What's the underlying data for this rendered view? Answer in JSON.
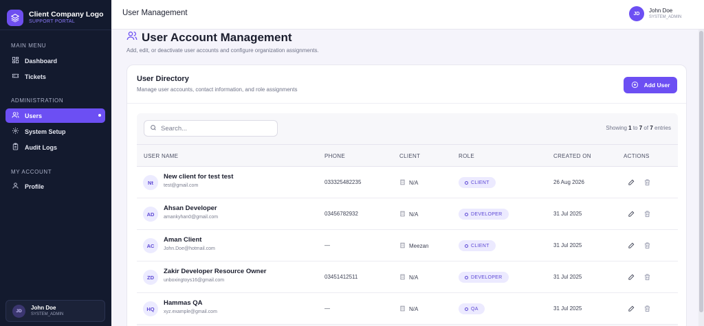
{
  "brand": {
    "title": "Client Company Logo",
    "subtitle": "SUPPORT PORTAL"
  },
  "sidebar": {
    "sections": [
      {
        "label": "MAIN MENU"
      },
      {
        "label": "ADMINISTRATION"
      },
      {
        "label": "MY ACCOUNT"
      }
    ],
    "items": [
      {
        "label": "Dashboard",
        "icon": "dashboard-icon"
      },
      {
        "label": "Tickets",
        "icon": "ticket-icon"
      },
      {
        "label": "Users",
        "icon": "users-icon",
        "active": true
      },
      {
        "label": "System Setup",
        "icon": "gear-icon"
      },
      {
        "label": "Audit Logs",
        "icon": "clipboard-icon"
      },
      {
        "label": "Profile",
        "icon": "user-icon"
      }
    ],
    "user": {
      "initials": "JD",
      "name": "John Doe",
      "role": "SYSTEM_ADMIN"
    }
  },
  "topbar": {
    "title": "User Management",
    "user": {
      "initials": "JD",
      "name": "John Doe",
      "role": "SYSTEM_ADMIN"
    }
  },
  "page": {
    "title": "User Account Management",
    "subtitle": "Add, edit, or deactivate user accounts and configure organization assignments."
  },
  "directory": {
    "title": "User Directory",
    "subtitle": "Manage user accounts, contact information, and role assignments",
    "add_button": "Add User",
    "search_placeholder": "Search...",
    "showing": {
      "prefix": "Showing ",
      "from": "1",
      "mid": " to ",
      "to": "7",
      "of": " of ",
      "total": "7",
      "suffix": " entries"
    },
    "columns": [
      "USER NAME",
      "PHONE",
      "CLIENT",
      "ROLE",
      "CREATED ON",
      "ACTIONS"
    ],
    "rows": [
      {
        "initials": "Nt",
        "name": "New client for test test",
        "email": "test@gmail.com",
        "phone": "033325482235",
        "client": "N/A",
        "role": "CLIENT",
        "created": "26 Aug 2026"
      },
      {
        "initials": "AD",
        "name": "Ahsan Developer",
        "email": "amankyhan0@gmail.com",
        "phone": "03456782932",
        "client": "N/A",
        "role": "DEVELOPER",
        "created": "31 Jul 2025"
      },
      {
        "initials": "AC",
        "name": "Aman Client",
        "email": "John.Doe@hotmail.com",
        "phone": "—",
        "client": "Meezan",
        "role": "CLIENT",
        "created": "31 Jul 2025"
      },
      {
        "initials": "ZD",
        "name": "Zakir Developer Resource Owner",
        "email": "unboxingtoys16@gmail.com",
        "phone": "03451412511",
        "client": "N/A",
        "role": "DEVELOPER",
        "created": "31 Jul 2025"
      },
      {
        "initials": "HQ",
        "name": "Hammas QA",
        "email": "xyz.example@gmail.com",
        "phone": "—",
        "client": "N/A",
        "role": "QA",
        "created": "31 Jul 2025"
      }
    ]
  },
  "colors": {
    "accent": "#6c4ff3",
    "sidebar_bg": "#131a2e"
  }
}
